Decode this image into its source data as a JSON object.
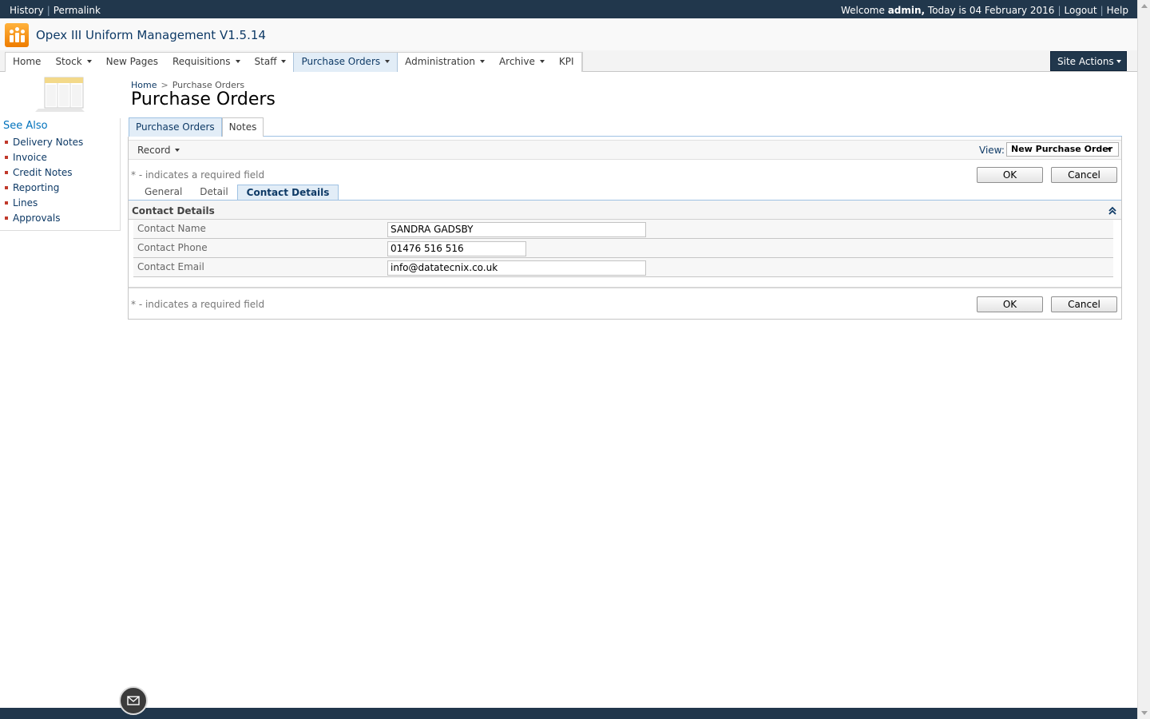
{
  "topbar": {
    "history": "History",
    "permalink": "Permalink",
    "welcome_prefix": "Welcome ",
    "user": "admin,",
    "today": " Today is 04 February 2016",
    "logout": "Logout",
    "help": "Help"
  },
  "site": {
    "title": "Opex III Uniform Management V1.5.14"
  },
  "nav": {
    "items": [
      {
        "label": "Home"
      },
      {
        "label": "Stock"
      },
      {
        "label": "New Pages"
      },
      {
        "label": "Requisitions"
      },
      {
        "label": "Staff"
      },
      {
        "label": "Purchase Orders"
      },
      {
        "label": "Administration"
      },
      {
        "label": "Archive"
      },
      {
        "label": "KPI"
      }
    ],
    "site_actions": "Site Actions"
  },
  "sidebar": {
    "see_also": "See Also",
    "links": [
      "Delivery Notes",
      "Invoice",
      "Credit Notes",
      "Reporting",
      "Lines",
      "Approvals"
    ]
  },
  "breadcrumb": {
    "home": "Home",
    "separator": ">",
    "current": "Purchase Orders"
  },
  "page": {
    "title": "Purchase Orders"
  },
  "tabs": [
    "Purchase Orders",
    "Notes"
  ],
  "toolbar": {
    "record": "Record",
    "view_label": "View:",
    "view_value": "New Purchase Order"
  },
  "form": {
    "required_note": "* - indicates a required field",
    "ok": "OK",
    "cancel": "Cancel",
    "subtabs": [
      "General",
      "Detail",
      "Contact Details"
    ],
    "section_title": "Contact Details",
    "fields": [
      {
        "label": "Contact Name",
        "value": "SANDRA GADSBY"
      },
      {
        "label": "Contact Phone",
        "value": "01476 516 516"
      },
      {
        "label": "Contact Email",
        "value": "info@datatecnix.co.uk"
      }
    ]
  },
  "colors": {
    "topbar": "#21374c",
    "accent": "#0072bc",
    "active_tab": "#e2edf7",
    "logo": "#ee7c00"
  }
}
